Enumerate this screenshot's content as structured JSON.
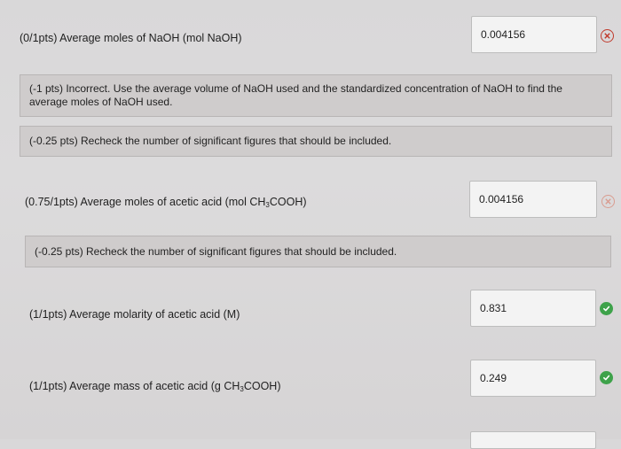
{
  "questions": [
    {
      "label_prefix": "(0/1pts)  Average moles of NaOH (mol NaOH)",
      "answer": "0.004156",
      "status": "incorrect"
    },
    {
      "label_prefix": "(0.75/1pts)  Average moles of acetic acid (mol CH",
      "label_sub": "3",
      "label_suffix": "COOH)",
      "answer": "0.004156",
      "status": "incorrect"
    },
    {
      "label_prefix": "(1/1pts)  Average molarity of acetic acid (M)",
      "answer": "0.831",
      "status": "correct"
    },
    {
      "label_prefix": "(1/1pts)  Average mass of acetic acid (g CH",
      "label_sub": "3",
      "label_suffix": "COOH)",
      "answer": "0.249",
      "status": "correct"
    }
  ],
  "feedback": [
    "(-1 pts) Incorrect. Use the average volume of NaOH used and the standardized concentration of NaOH to find the average moles of NaOH used.",
    "(-0.25 pts) Recheck the number of significant figures that should be included.",
    "(-0.25 pts) Recheck the number of significant figures that should be included."
  ],
  "colors": {
    "incorrect": "#c0392b",
    "correct": "#3ea24a",
    "feedback_bg": "#cfcccc"
  },
  "icons": {
    "incorrect": "x-circle-icon",
    "correct": "checkmark-circle-icon"
  }
}
